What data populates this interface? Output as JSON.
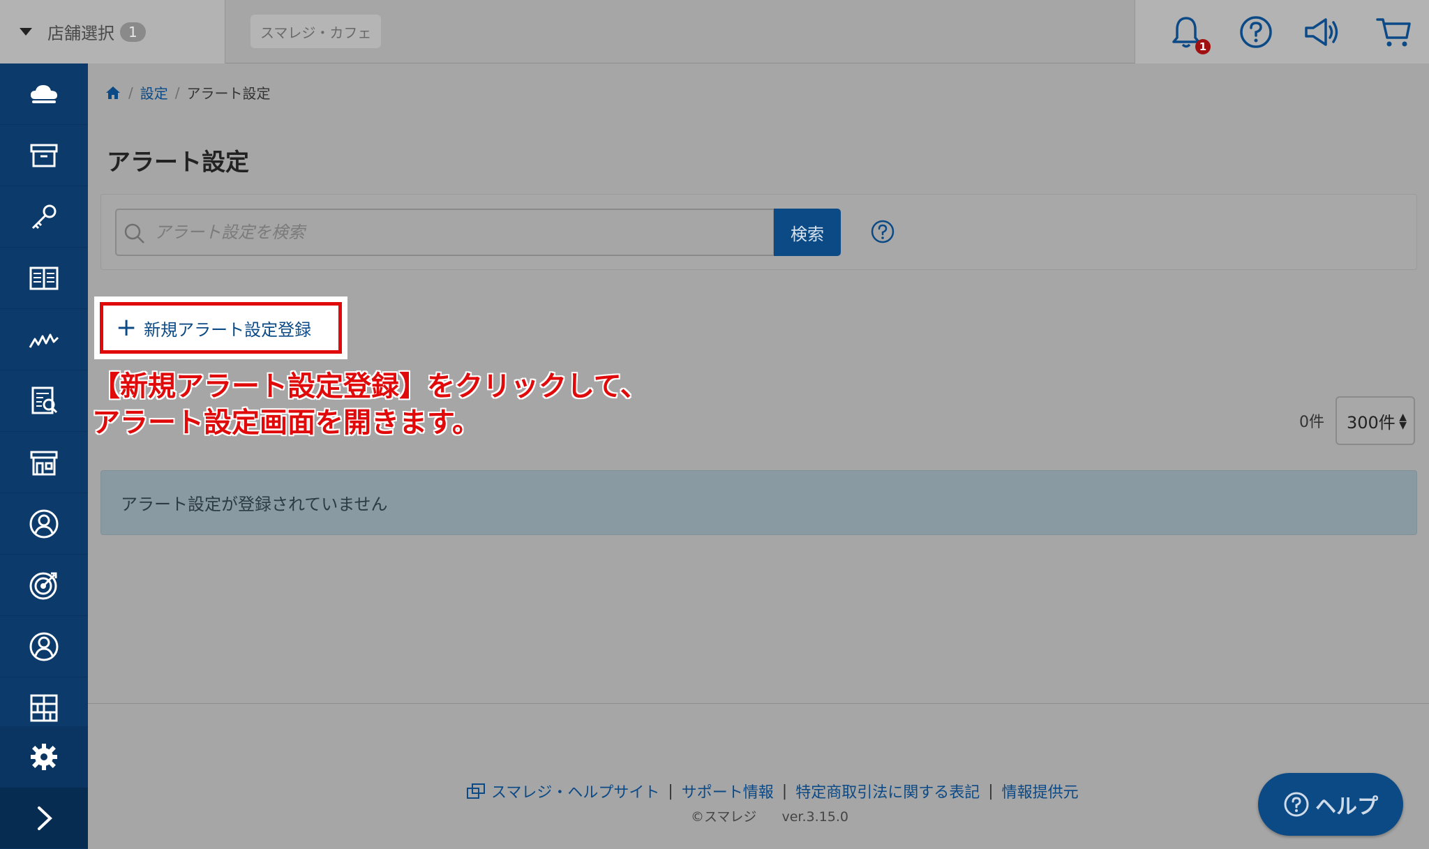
{
  "topbar": {
    "store_select_label": "店舗選択",
    "store_count": "1",
    "store_name": "スマレジ・カフェ",
    "notification_count": "1",
    "icons": [
      "bell-icon",
      "help-icon",
      "megaphone-icon",
      "cart-icon"
    ]
  },
  "sidebar": {
    "items": [
      "cloud-icon",
      "box-icon",
      "key-icon",
      "book-icon",
      "chart-icon",
      "report-icon",
      "store-icon",
      "customer-icon",
      "target-icon",
      "user-icon",
      "grid-icon"
    ],
    "settings_icon": "gear-icon",
    "expand_icon": "chevron-right-icon"
  },
  "breadcrumb": {
    "home_icon": "home-icon",
    "settings": "設定",
    "current": "アラート設定"
  },
  "page": {
    "title": "アラート設定"
  },
  "search": {
    "placeholder": "アラート設定を検索",
    "button_label": "検索"
  },
  "actions": {
    "new_label": "新規アラート設定登録"
  },
  "annotation": {
    "line1": "【新規アラート設定登録】をクリックして、",
    "line2": "アラート設定画面を開きます。"
  },
  "list": {
    "count_label": "0件",
    "per_page": "300件",
    "empty_message": "アラート設定が登録されていません"
  },
  "footer": {
    "help_site": "スマレジ・ヘルプサイト",
    "support": "サポート情報",
    "legal": "特定商取引法に関する表記",
    "info_provider": "情報提供元",
    "copyright": "©スマレジ",
    "version": "ver.3.15.0"
  },
  "help_button": {
    "label": "ヘルプ"
  },
  "colors": {
    "sidebar": "#0b3a6b",
    "accent": "#0c4a85",
    "highlight": "#e10a0a"
  }
}
